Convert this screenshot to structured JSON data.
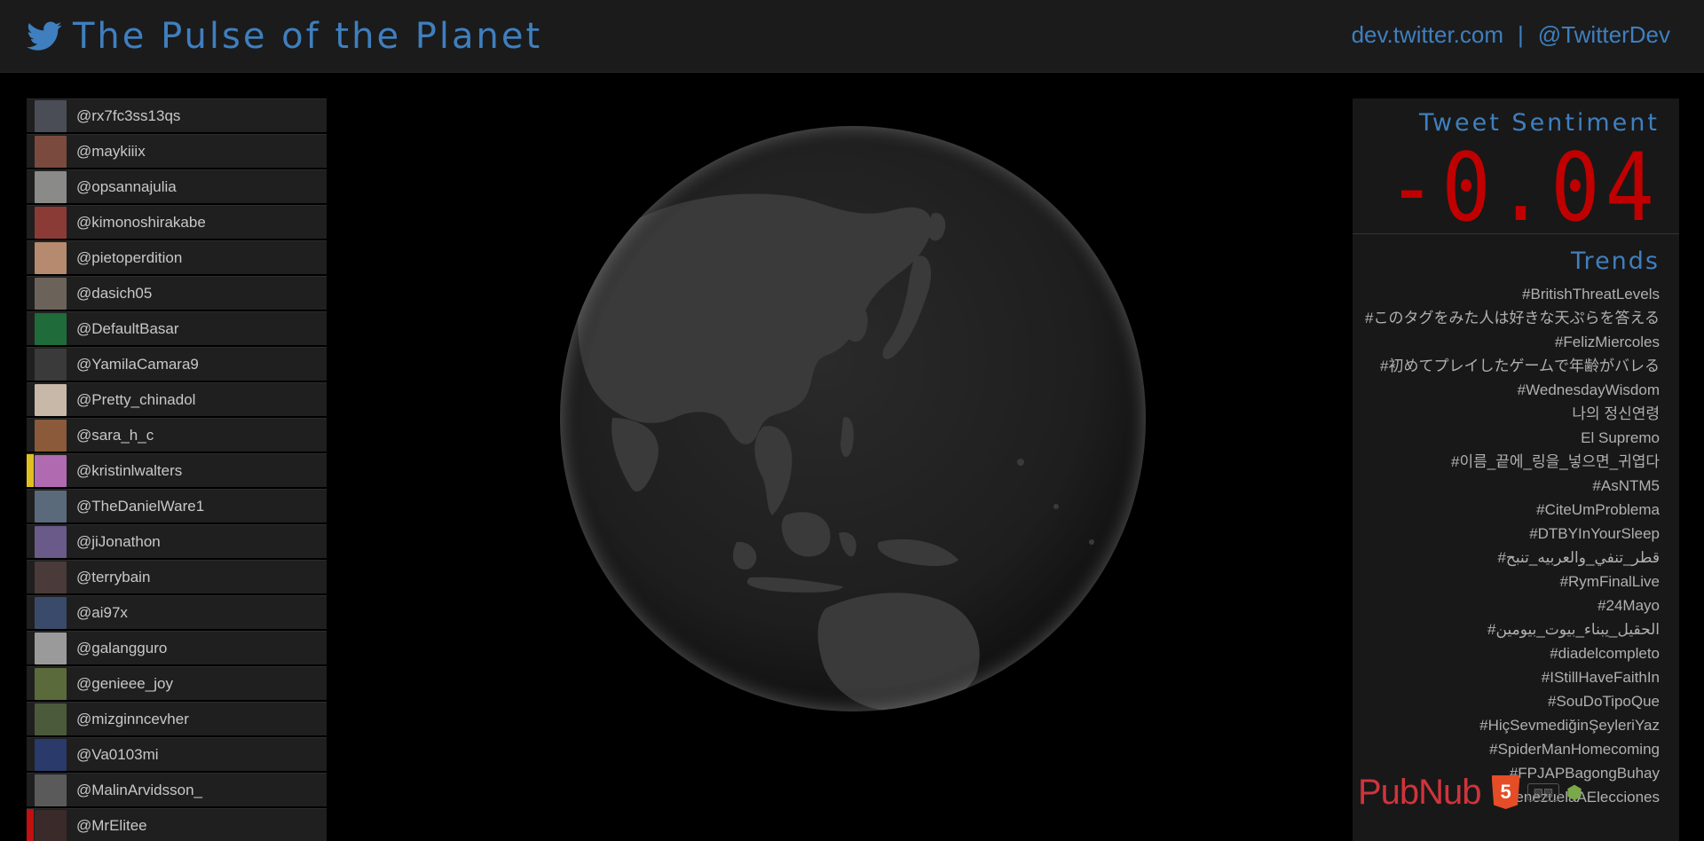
{
  "header": {
    "title": "The Pulse of the Planet",
    "links": [
      "dev.twitter.com",
      "@TwitterDev"
    ],
    "separator": "|"
  },
  "users": [
    {
      "handle": "@rx7fc3ss13qs",
      "flag": "",
      "avatar": "#4a4d55"
    },
    {
      "handle": "@maykiiix",
      "flag": "",
      "avatar": "#7a4a3f"
    },
    {
      "handle": "@opsannajulia",
      "flag": "",
      "avatar": "#8a8a88"
    },
    {
      "handle": "@kimonoshirakabe",
      "flag": "",
      "avatar": "#8a3b36"
    },
    {
      "handle": "@pietoperdition",
      "flag": "",
      "avatar": "#b58a6e"
    },
    {
      "handle": "@dasich05",
      "flag": "",
      "avatar": "#6b625a"
    },
    {
      "handle": "@DefaultBasar",
      "flag": "",
      "avatar": "#1f6b3a"
    },
    {
      "handle": "@YamilaCamara9",
      "flag": "",
      "avatar": "#3a3a3a"
    },
    {
      "handle": "@Pretty_chinadol",
      "flag": "",
      "avatar": "#c7b8a8"
    },
    {
      "handle": "@sara_h_c",
      "flag": "",
      "avatar": "#8a5a3a"
    },
    {
      "handle": "@kristinlwalters",
      "flag": "#e0c020",
      "avatar": "#b06ab0"
    },
    {
      "handle": "@TheDanielWare1",
      "flag": "",
      "avatar": "#5a6a7a"
    },
    {
      "handle": "@jiJonathon",
      "flag": "",
      "avatar": "#6a5a8a"
    },
    {
      "handle": "@terrybain",
      "flag": "",
      "avatar": "#4a3a3a"
    },
    {
      "handle": "@ai97x",
      "flag": "",
      "avatar": "#3a4a6a"
    },
    {
      "handle": "@galangguro",
      "flag": "",
      "avatar": "#9a9a9a"
    },
    {
      "handle": "@genieee_joy",
      "flag": "",
      "avatar": "#5a6a3a"
    },
    {
      "handle": "@mizginncevher",
      "flag": "",
      "avatar": "#4a5a3a"
    },
    {
      "handle": "@Va0103mi",
      "flag": "",
      "avatar": "#2a3a6a"
    },
    {
      "handle": "@MalinArvidsson_",
      "flag": "",
      "avatar": "#5a5a5a"
    },
    {
      "handle": "@MrElitee",
      "flag": "#c01010",
      "avatar": "#3a2a2a"
    }
  ],
  "sentiment": {
    "title": "Tweet Sentiment",
    "value": "-0.04",
    "color": "#c00000"
  },
  "trends": {
    "title": "Trends",
    "items": [
      "#BritishThreatLevels",
      "#このタグをみた人は好きな天ぷらを答える",
      "#FelizMiercoles",
      "#初めてプレイしたゲームで年齢がバレる",
      "#WednesdayWisdom",
      "나의 정신연령",
      "El Supremo",
      "#이름_끝에_링을_넣으면_귀엽다",
      "#AsNTM5",
      "#CiteUmProblema",
      "#DTBYInYourSleep",
      "#قطر_تنفي_والعربيه_تنبح",
      "#RymFinalLive",
      "#24Mayo",
      "#الحقيل_يبناء_بيوت_بيومين",
      "#diadelcompleto",
      "#IStillHaveFaithIn",
      "#SouDoTipoQue",
      "#HiçSevmediğinŞeyleriYaz",
      "#SpiderManHomecoming",
      "#FPJAPBagongBuhay",
      "#VenezuelaAElecciones"
    ]
  },
  "footer": {
    "pubnub": "PubNub",
    "html5": "5"
  },
  "colors": {
    "accent": "#3f7fbf",
    "background": "#000000",
    "panel": "#181818"
  }
}
